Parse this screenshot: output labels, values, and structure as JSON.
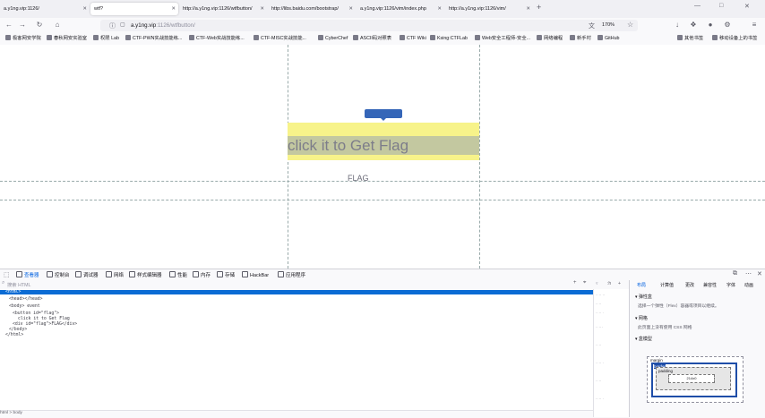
{
  "tabs": [
    {
      "label": "a.y1ng.vip:1126/"
    },
    {
      "label": "wtf?"
    },
    {
      "label": "http://a.y1ng.vip:1126/wtfbutton/"
    },
    {
      "label": "http://libs.baidu.com/bootstrap/"
    },
    {
      "label": "a.y1ng.vip:1126/vim/index.php"
    },
    {
      "label": "http://a.y1ng.vip:1126/vim/"
    }
  ],
  "address": {
    "host": "a.y1ng.vip",
    "path": ":1126/wtfbutton/",
    "zoom": "170%"
  },
  "bookmarks": [
    "极客网安学院",
    "春秋网安实验室",
    "权限 Lab",
    "CTF-PWN实战技能练...",
    "CTF-Web实战技能练...",
    "CTF-MISC实战技能...",
    "CyberChef",
    "ASCII码对照表",
    "CTF Wiki",
    "Ksing:CTFLab",
    "Web安全工程师-安全...",
    "网络编程",
    "新手村",
    "GitHub",
    "其他书签",
    "移动设备上的书签"
  ],
  "page": {
    "button_text": "click it to Get Flag",
    "flag_text": "FLAG"
  },
  "devtools": {
    "tabs": [
      "查看器",
      "控制台",
      "调试器",
      "网络",
      "样式编辑器",
      "性能",
      "内存",
      "存储",
      "HackBar",
      "应用程序"
    ],
    "search_placeholder": "搜索 HTML",
    "markup_lines": [
      "<html>",
      "<head></head>",
      "<body>  event",
      "<button id=\"flag\">",
      "click it to Get Flag",
      "<div id=\"flag\">FLAG</div>",
      "</body>",
      "</html>"
    ],
    "breadcrumb": "html > body",
    "side_tabs": [
      "布局",
      "计算值",
      "更改",
      "兼容性",
      "字体",
      "动画"
    ],
    "sections": {
      "flexbox": "弹性盒",
      "flexbox_hint": "选择一个弹性（Flex）容器或项目以继续。",
      "grid": "网格",
      "grid_hint": "此页面上没有使用 CSS 网格",
      "box_model": "盒模型"
    },
    "box_model": {
      "margin": "margin",
      "border": "border",
      "padding": "padding",
      "content": "214x0"
    }
  }
}
